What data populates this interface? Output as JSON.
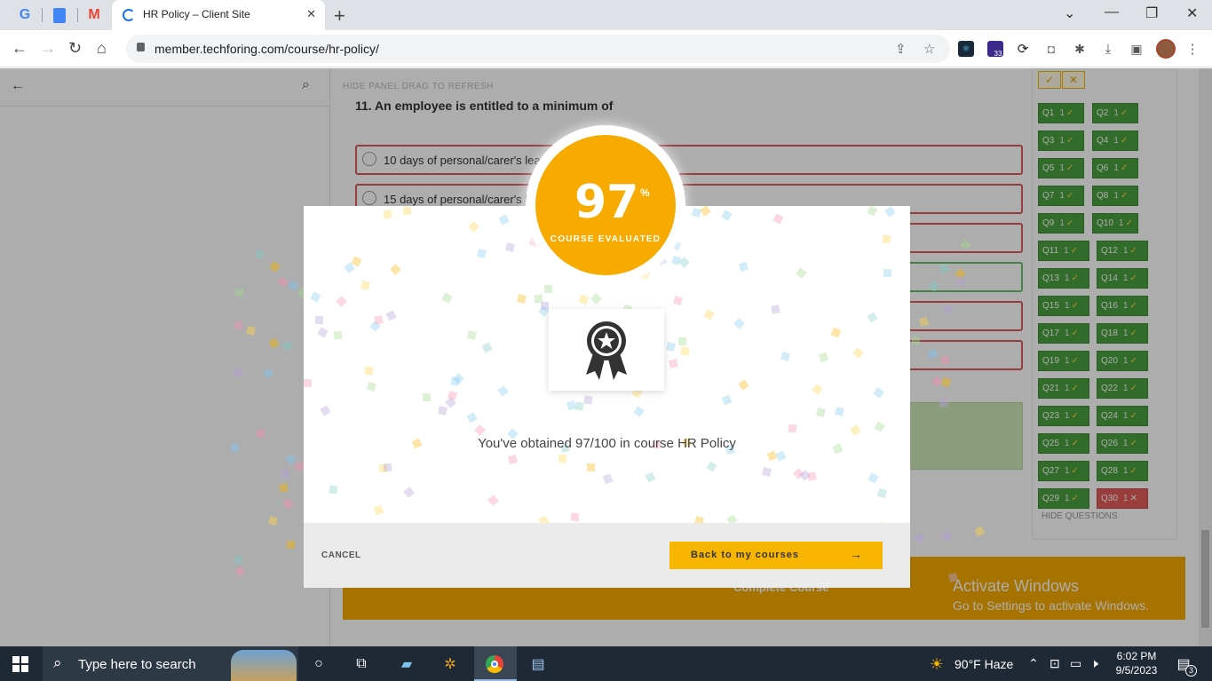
{
  "browser": {
    "tab_title": "HR Policy – Client Site",
    "url": "member.techforing.com/course/hr-policy/",
    "extension_badge": "33"
  },
  "page": {
    "panel_controls": "HIDE PANEL   DRAG TO REFRESH",
    "question_text": "11. An employee is entitled to a minimum of",
    "options": [
      "10 days of personal/carer's leave",
      "15 days of personal/carer's leave"
    ],
    "complete_course_label": "Complete Course",
    "activate_title": "Activate Windows",
    "activate_sub": "Go to Settings to activate Windows.",
    "hide_questions": "HIDE QUESTIONS",
    "question_buttons": [
      {
        "label": "Q1",
        "points": "1",
        "status": "correct"
      },
      {
        "label": "Q2",
        "points": "1",
        "status": "correct"
      },
      {
        "label": "Q3",
        "points": "1",
        "status": "correct"
      },
      {
        "label": "Q4",
        "points": "1",
        "status": "correct"
      },
      {
        "label": "Q5",
        "points": "1",
        "status": "correct"
      },
      {
        "label": "Q6",
        "points": "1",
        "status": "correct"
      },
      {
        "label": "Q7",
        "points": "1",
        "status": "correct"
      },
      {
        "label": "Q8",
        "points": "1",
        "status": "correct"
      },
      {
        "label": "Q9",
        "points": "1",
        "status": "correct"
      },
      {
        "label": "Q10",
        "points": "1",
        "status": "correct"
      },
      {
        "label": "Q11",
        "points": "1",
        "status": "correct"
      },
      {
        "label": "Q12",
        "points": "1",
        "status": "correct"
      },
      {
        "label": "Q13",
        "points": "1",
        "status": "correct"
      },
      {
        "label": "Q14",
        "points": "1",
        "status": "correct"
      },
      {
        "label": "Q15",
        "points": "1",
        "status": "correct"
      },
      {
        "label": "Q16",
        "points": "1",
        "status": "correct"
      },
      {
        "label": "Q17",
        "points": "1",
        "status": "correct"
      },
      {
        "label": "Q18",
        "points": "1",
        "status": "correct"
      },
      {
        "label": "Q19",
        "points": "1",
        "status": "correct"
      },
      {
        "label": "Q20",
        "points": "1",
        "status": "correct"
      },
      {
        "label": "Q21",
        "points": "1",
        "status": "correct"
      },
      {
        "label": "Q22",
        "points": "1",
        "status": "correct"
      },
      {
        "label": "Q23",
        "points": "1",
        "status": "correct"
      },
      {
        "label": "Q24",
        "points": "1",
        "status": "correct"
      },
      {
        "label": "Q25",
        "points": "1",
        "status": "correct"
      },
      {
        "label": "Q26",
        "points": "1",
        "status": "correct"
      },
      {
        "label": "Q27",
        "points": "1",
        "status": "correct"
      },
      {
        "label": "Q28",
        "points": "1",
        "status": "correct"
      },
      {
        "label": "Q29",
        "points": "1",
        "status": "correct"
      },
      {
        "label": "Q30",
        "points": "1",
        "status": "wrong"
      }
    ]
  },
  "modal": {
    "score": "97",
    "percent_sign": "%",
    "badge_caption": "COURSE EVALUATED",
    "message": "You've obtained 97/100 in course HR Policy",
    "cancel_label": "CANCEL",
    "back_label": "Back to my courses"
  },
  "taskbar": {
    "search_placeholder": "Type here to search",
    "weather": "90°F  Haze",
    "time": "6:02 PM",
    "date": "9/5/2023",
    "notification_count": "3"
  },
  "colors": {
    "accent": "#f7ab00",
    "correct": "#4aa03e",
    "wrong": "#e25b5b"
  }
}
